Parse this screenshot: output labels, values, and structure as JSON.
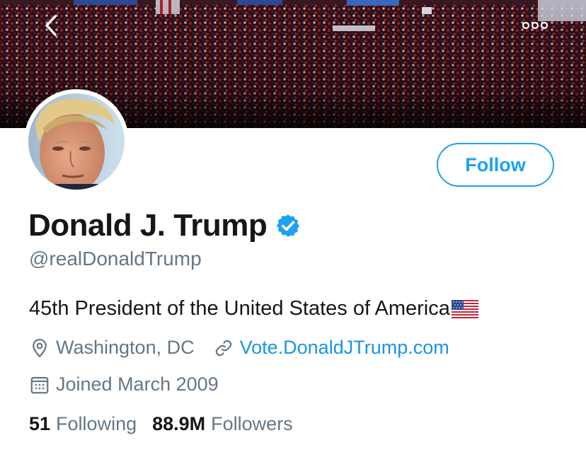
{
  "profile": {
    "display_name": "Donald J. Trump",
    "handle": "@realDonaldTrump",
    "verified": true,
    "bio": "45th President of the United States of America",
    "location": "Washington, DC",
    "website": "Vote.DonaldJTrump.com",
    "joined": "Joined March 2009"
  },
  "actions": {
    "follow_label": "Follow"
  },
  "stats": {
    "following_count": "51",
    "following_label": "Following",
    "followers_count": "88.9M",
    "followers_label": "Followers"
  },
  "icons": {
    "back": "chevron-left-icon",
    "more": "more-dots-icon",
    "verified": "verified-badge-icon",
    "location": "location-pin-icon",
    "link": "link-icon",
    "calendar": "calendar-icon",
    "flag": "us-flag-emoji"
  },
  "colors": {
    "accent": "#1da1f2",
    "link": "#1b95e0",
    "text_primary": "#14171a",
    "text_secondary": "#657786"
  }
}
